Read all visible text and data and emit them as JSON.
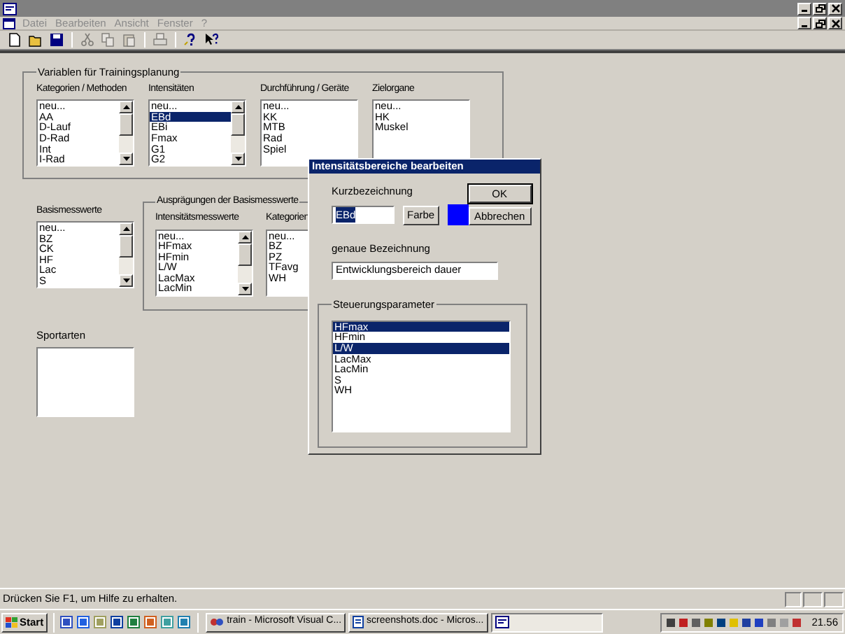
{
  "menu": [
    {
      "label": "Datei",
      "disabled": true
    },
    {
      "label": "Bearbeiten",
      "disabled": true
    },
    {
      "label": "Ansicht",
      "disabled": true
    },
    {
      "label": "Fenster",
      "disabled": true
    },
    {
      "label": "?",
      "disabled": true
    }
  ],
  "toolbar": [
    {
      "kind": "new",
      "disabled": false
    },
    {
      "kind": "open",
      "disabled": false
    },
    {
      "kind": "save",
      "disabled": false
    },
    {
      "kind": "sep"
    },
    {
      "kind": "cut",
      "disabled": true
    },
    {
      "kind": "copy",
      "disabled": true
    },
    {
      "kind": "paste",
      "disabled": true
    },
    {
      "kind": "sep"
    },
    {
      "kind": "print",
      "disabled": true
    },
    {
      "kind": "sep"
    },
    {
      "kind": "about",
      "disabled": false
    },
    {
      "kind": "context_help",
      "disabled": false
    }
  ],
  "planning_group": {
    "title": "Variablen für Trainingsplanung",
    "lists": [
      {
        "label": "Kategorien / Methoden",
        "scrollable": true,
        "items": [
          {
            "text": "neu...",
            "selected": false
          },
          {
            "text": "AA",
            "selected": false
          },
          {
            "text": "D-Lauf",
            "selected": false
          },
          {
            "text": "D-Rad",
            "selected": false
          },
          {
            "text": "Int",
            "selected": false
          },
          {
            "text": "I-Rad",
            "selected": false
          }
        ]
      },
      {
        "label": "Intensitäten",
        "scrollable": true,
        "items": [
          {
            "text": "neu...",
            "selected": false
          },
          {
            "text": "EBd",
            "selected": true
          },
          {
            "text": "EBi",
            "selected": false
          },
          {
            "text": "Fmax",
            "selected": false
          },
          {
            "text": "G1",
            "selected": false
          },
          {
            "text": "G2",
            "selected": false
          }
        ]
      },
      {
        "label": "Durchführung / Geräte",
        "scrollable": false,
        "items": [
          {
            "text": "neu...",
            "selected": false
          },
          {
            "text": "KK",
            "selected": false
          },
          {
            "text": "MTB",
            "selected": false
          },
          {
            "text": "Rad",
            "selected": false
          },
          {
            "text": "Spiel",
            "selected": false
          }
        ]
      },
      {
        "label": "Zielorgane",
        "scrollable": false,
        "items": [
          {
            "text": "neu...",
            "selected": false
          },
          {
            "text": "HK",
            "selected": false
          },
          {
            "text": "Muskel",
            "selected": false
          }
        ]
      }
    ]
  },
  "base_list": {
    "label": "Basismesswerte",
    "scrollable": true,
    "items": [
      {
        "text": "neu...",
        "selected": false
      },
      {
        "text": "BZ",
        "selected": false
      },
      {
        "text": "CK",
        "selected": false
      },
      {
        "text": "HF",
        "selected": false
      },
      {
        "text": "Lac",
        "selected": false
      },
      {
        "text": "S",
        "selected": false
      }
    ]
  },
  "values_group": {
    "title": "Ausprägungen der Basismesswerte",
    "lists": [
      {
        "label": "Intensitätsmesswerte",
        "scrollable": true,
        "items": [
          {
            "text": "neu...",
            "selected": false
          },
          {
            "text": "HFmax",
            "selected": false
          },
          {
            "text": "HFmin",
            "selected": false
          },
          {
            "text": "L/W",
            "selected": false
          },
          {
            "text": "LacMax",
            "selected": false
          },
          {
            "text": "LacMin",
            "selected": false
          }
        ]
      },
      {
        "label": "Kategorien",
        "items": [
          {
            "text": "neu...",
            "selected": false
          },
          {
            "text": "BZ",
            "selected": false
          },
          {
            "text": "PZ",
            "selected": false
          },
          {
            "text": "TFavg",
            "selected": false
          },
          {
            "text": "WH",
            "selected": false
          }
        ]
      }
    ]
  },
  "sports": {
    "label": "Sportarten"
  },
  "dialog": {
    "title": "Intensitätsbereiche bearbeiten",
    "short_label": "Kurzbezeichnung",
    "short_value": "EBd",
    "short_text_selected": true,
    "color_button": "Farbe",
    "color": "#0000ff",
    "ok": "OK",
    "cancel": "Abbrechen",
    "full_label": "genaue Bezeichnung",
    "full_value": "Entwicklungsbereich dauer",
    "params": {
      "title": "Steuerungsparameter",
      "items": [
        {
          "text": "HFmax",
          "selected": true
        },
        {
          "text": "HFmin",
          "selected": false
        },
        {
          "text": "L/W",
          "selected": true
        },
        {
          "text": "LacMax",
          "selected": false
        },
        {
          "text": "LacMin",
          "selected": false
        },
        {
          "text": "S",
          "selected": false
        },
        {
          "text": "WH",
          "selected": false
        }
      ]
    }
  },
  "status_bar": {
    "text": "Drücken Sie F1, um Hilfe zu erhalten."
  },
  "taskbar": {
    "start": "Start",
    "tasks": [
      {
        "label": "train - Microsoft Visual C...",
        "kind": "studio",
        "selected": false
      },
      {
        "label": "screenshots.doc - Micros...",
        "kind": "doc",
        "selected": false
      },
      {
        "kind": "app",
        "selected": true
      }
    ],
    "clock": "21.56"
  }
}
